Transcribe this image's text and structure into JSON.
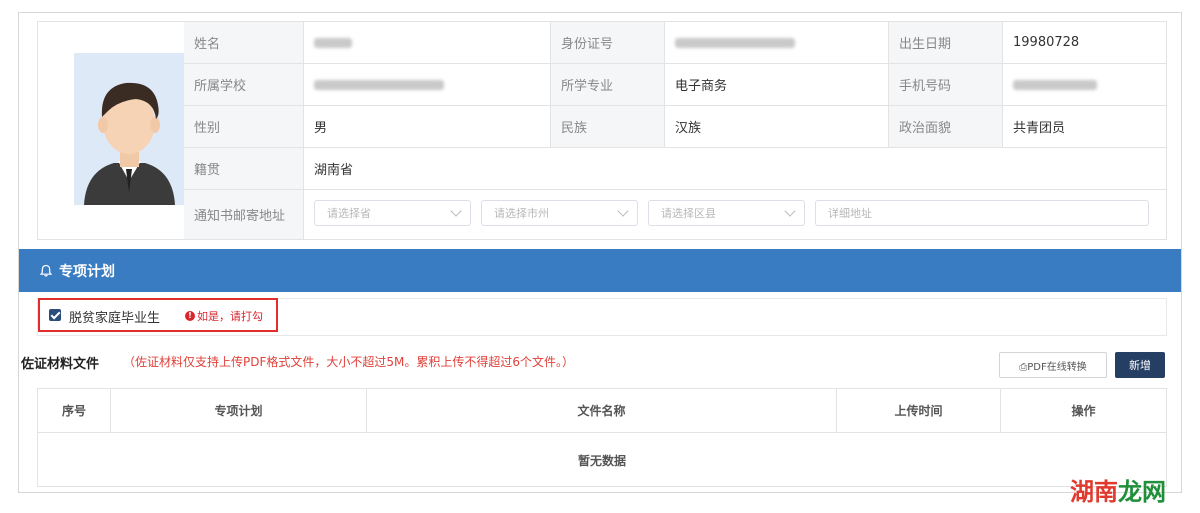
{
  "info": {
    "rows": [
      [
        {
          "label": "姓名",
          "value": ""
        },
        {
          "label": "身份证号",
          "value": ""
        },
        {
          "label": "出生日期",
          "value": "19980728"
        }
      ],
      [
        {
          "label": "所属学校",
          "value": ""
        },
        {
          "label": "所学专业",
          "value": "电子商务"
        },
        {
          "label": "手机号码",
          "value": ""
        }
      ],
      [
        {
          "label": "性别",
          "value": "男"
        },
        {
          "label": "民族",
          "value": "汉族"
        },
        {
          "label": "政治面貌",
          "value": "共青团员"
        }
      ]
    ],
    "native_label": "籍贯",
    "native_value": "湖南省",
    "address_label": "通知书邮寄地址",
    "province_placeholder": "请选择省",
    "city_placeholder": "请选择市州",
    "district_placeholder": "请选择区县",
    "detail_placeholder": "详细地址"
  },
  "section": {
    "title": "专项计划"
  },
  "poverty": {
    "label": "脱贫家庭毕业生",
    "checked": true,
    "hint": "如是，请打勾"
  },
  "materials": {
    "title": "佐证材料文件",
    "note": "（佐证材料仅支持上传PDF格式文件，大小不超过5M。累积上传不得超过6个文件。）",
    "pdf_button": "⎙PDF在线转换",
    "new_button": "新增",
    "columns": [
      "序号",
      "专项计划",
      "文件名称",
      "上传时间",
      "操作"
    ],
    "empty_text": "暂无数据"
  },
  "watermark": {
    "part1": "湖南",
    "part2": "龙网"
  },
  "colors": {
    "section_blue": "#3a7cc2",
    "warn_red": "#d8262e",
    "button_navy": "#253e63"
  }
}
